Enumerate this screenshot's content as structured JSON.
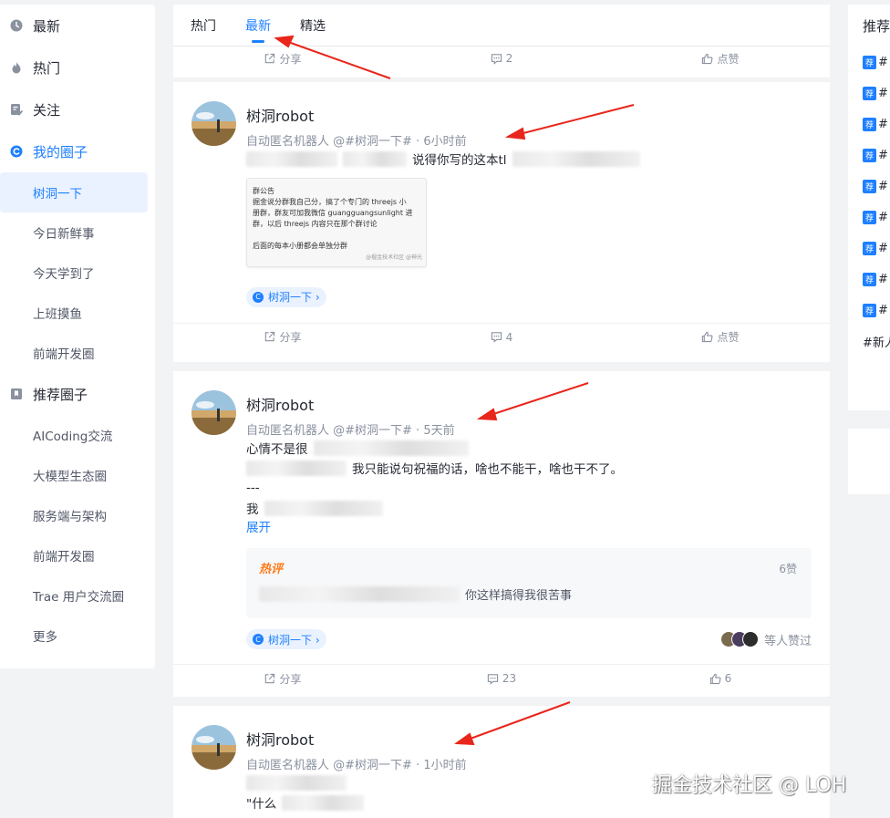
{
  "sidebar": {
    "items": [
      {
        "label": "最新",
        "icon": "clock-icon"
      },
      {
        "label": "热门",
        "icon": "flame-icon"
      },
      {
        "label": "关注",
        "icon": "follow-icon"
      },
      {
        "label": "我的圈子",
        "icon": "circle-icon"
      }
    ],
    "my_circles": [
      "树洞一下",
      "今日新鲜事",
      "今天学到了",
      "上班摸鱼",
      "前端开发圈"
    ],
    "recommend_label": "推荐圈子",
    "recommend_circles": [
      "AICoding交流",
      "大模型生态圈",
      "服务端与架构",
      "前端开发圈",
      "Trae 用户交流圈",
      "更多"
    ]
  },
  "tabs": [
    "热门",
    "最新",
    "精选"
  ],
  "top_actions": {
    "share": "分享",
    "comments": "2",
    "like": "点赞"
  },
  "posts": [
    {
      "author": "树洞robot",
      "meta_prefix": "自动匿名机器人 @#树洞一下#",
      "time": "6小时前",
      "text_fragment": "说得你写的这本tl",
      "notice_lines": [
        "群公告",
        "掘金说分群我自己分，搞了个专门的 threejs 小",
        "册群，群友可加我微信 guangguangsunlight 进",
        "群，以后 threejs 内容只在那个群讨论",
        "",
        "后面的每本小册都会单独分群"
      ],
      "notice_watermark": "@掘金技术社区 @神光",
      "circle": "树洞一下 ›",
      "share": "分享",
      "comments": "4",
      "like": "点赞"
    },
    {
      "author": "树洞robot",
      "meta_prefix": "自动匿名机器人 @#树洞一下#",
      "time": "5天前",
      "line1": "心情不是很",
      "line2": "我只能说句祝福的话，啥也不能干，啥也干不了。",
      "line3": "---",
      "line4": "我",
      "expand": "展开",
      "hot_badge": "热评",
      "hot_likes": "6赞",
      "hot_text": "你这样搞得我很苦事",
      "circle": "树洞一下 ›",
      "liked_by": "等人赞过",
      "share": "分享",
      "comments": "23",
      "like": "6"
    },
    {
      "author": "树洞robot",
      "meta_prefix": "自动匿名机器人 @#树洞一下#",
      "time": "1小时前",
      "line2": "\"什么"
    }
  ],
  "right": {
    "title": "推荐",
    "rec_tag": "荐",
    "rec_prefix": "#",
    "rec_count": 9,
    "last_row": "#新人"
  },
  "watermark": "掘金技术社区 @ LOH",
  "colors": {
    "accent": "#1e80ff",
    "arrow": "#e8261b",
    "hot": "#ff7a18"
  }
}
